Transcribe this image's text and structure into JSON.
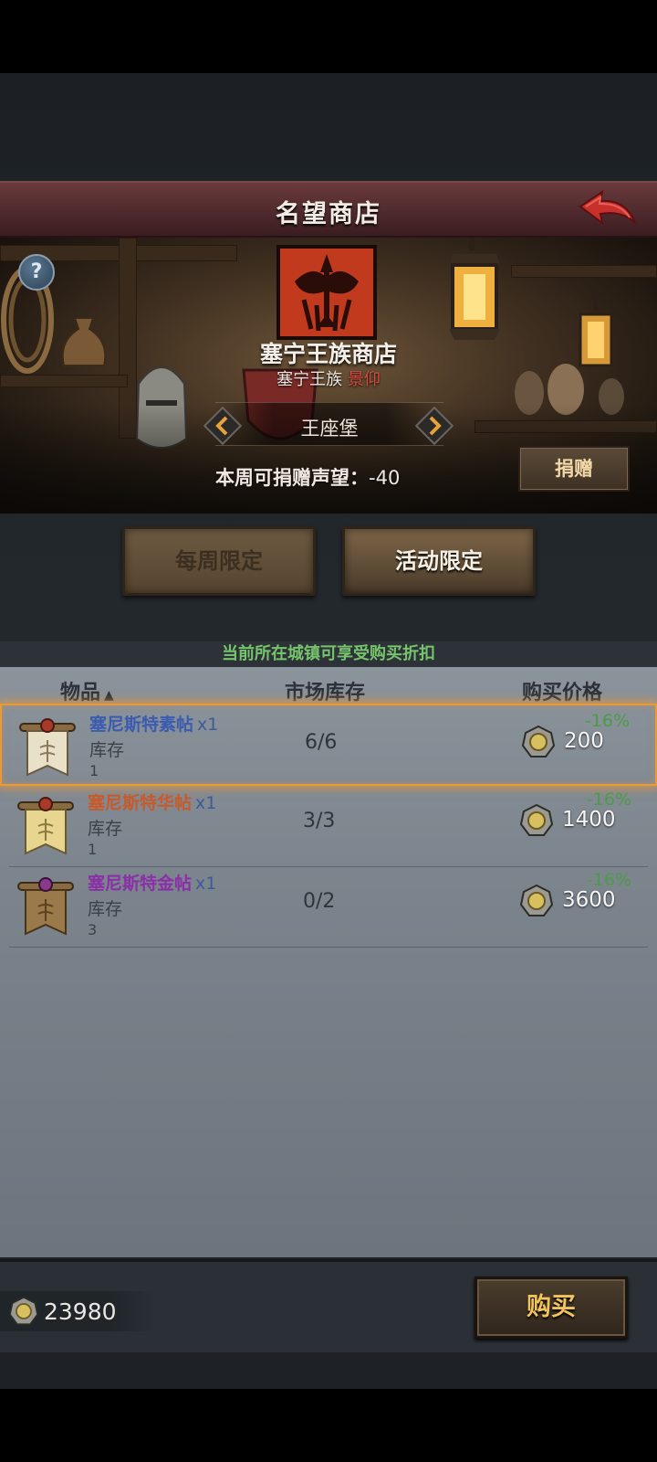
{
  "header": {
    "title": "名望商店",
    "back_icon": "back-arrow-icon"
  },
  "faction": {
    "name": "塞宁王族商店",
    "status_name": "塞宁王族",
    "reputation_level": "景仰",
    "town": "王座堡",
    "donate_label": "本周可捐赠声望：",
    "donate_value": "-40",
    "donate_button": "捐赠",
    "help": "?"
  },
  "tabs": [
    {
      "label": "每周限定",
      "active": false
    },
    {
      "label": "活动限定",
      "active": true
    }
  ],
  "discount_banner": "当前所在城镇可享受购买折扣",
  "columns": {
    "item": "物品",
    "sort": "▲",
    "stock": "市场库存",
    "price": "购买价格"
  },
  "items": [
    {
      "name": "塞尼斯特素帖",
      "qty": "x1",
      "name_color": "#3a5bb0",
      "stock_label": "库存",
      "stock_count": "1",
      "market_stock": "6/6",
      "price": "200",
      "discount": "-16%",
      "selected": true
    },
    {
      "name": "塞尼斯特华帖",
      "qty": "x1",
      "name_color": "#c85a2a",
      "stock_label": "库存",
      "stock_count": "1",
      "market_stock": "3/3",
      "price": "1400",
      "discount": "-16%",
      "selected": false
    },
    {
      "name": "塞尼斯特金帖",
      "qty": "x1",
      "name_color": "#8a2fa8",
      "stock_label": "库存",
      "stock_count": "3",
      "market_stock": "0/2",
      "price": "3600",
      "discount": "-16%",
      "selected": false
    }
  ],
  "footer": {
    "currency_amount": "23980",
    "buy_button": "购买"
  },
  "colors": {
    "header": "#4f2a2d",
    "discount_green": "#4a9d45",
    "selected_outline": "#e89a38",
    "gold": "#f1c45c"
  }
}
